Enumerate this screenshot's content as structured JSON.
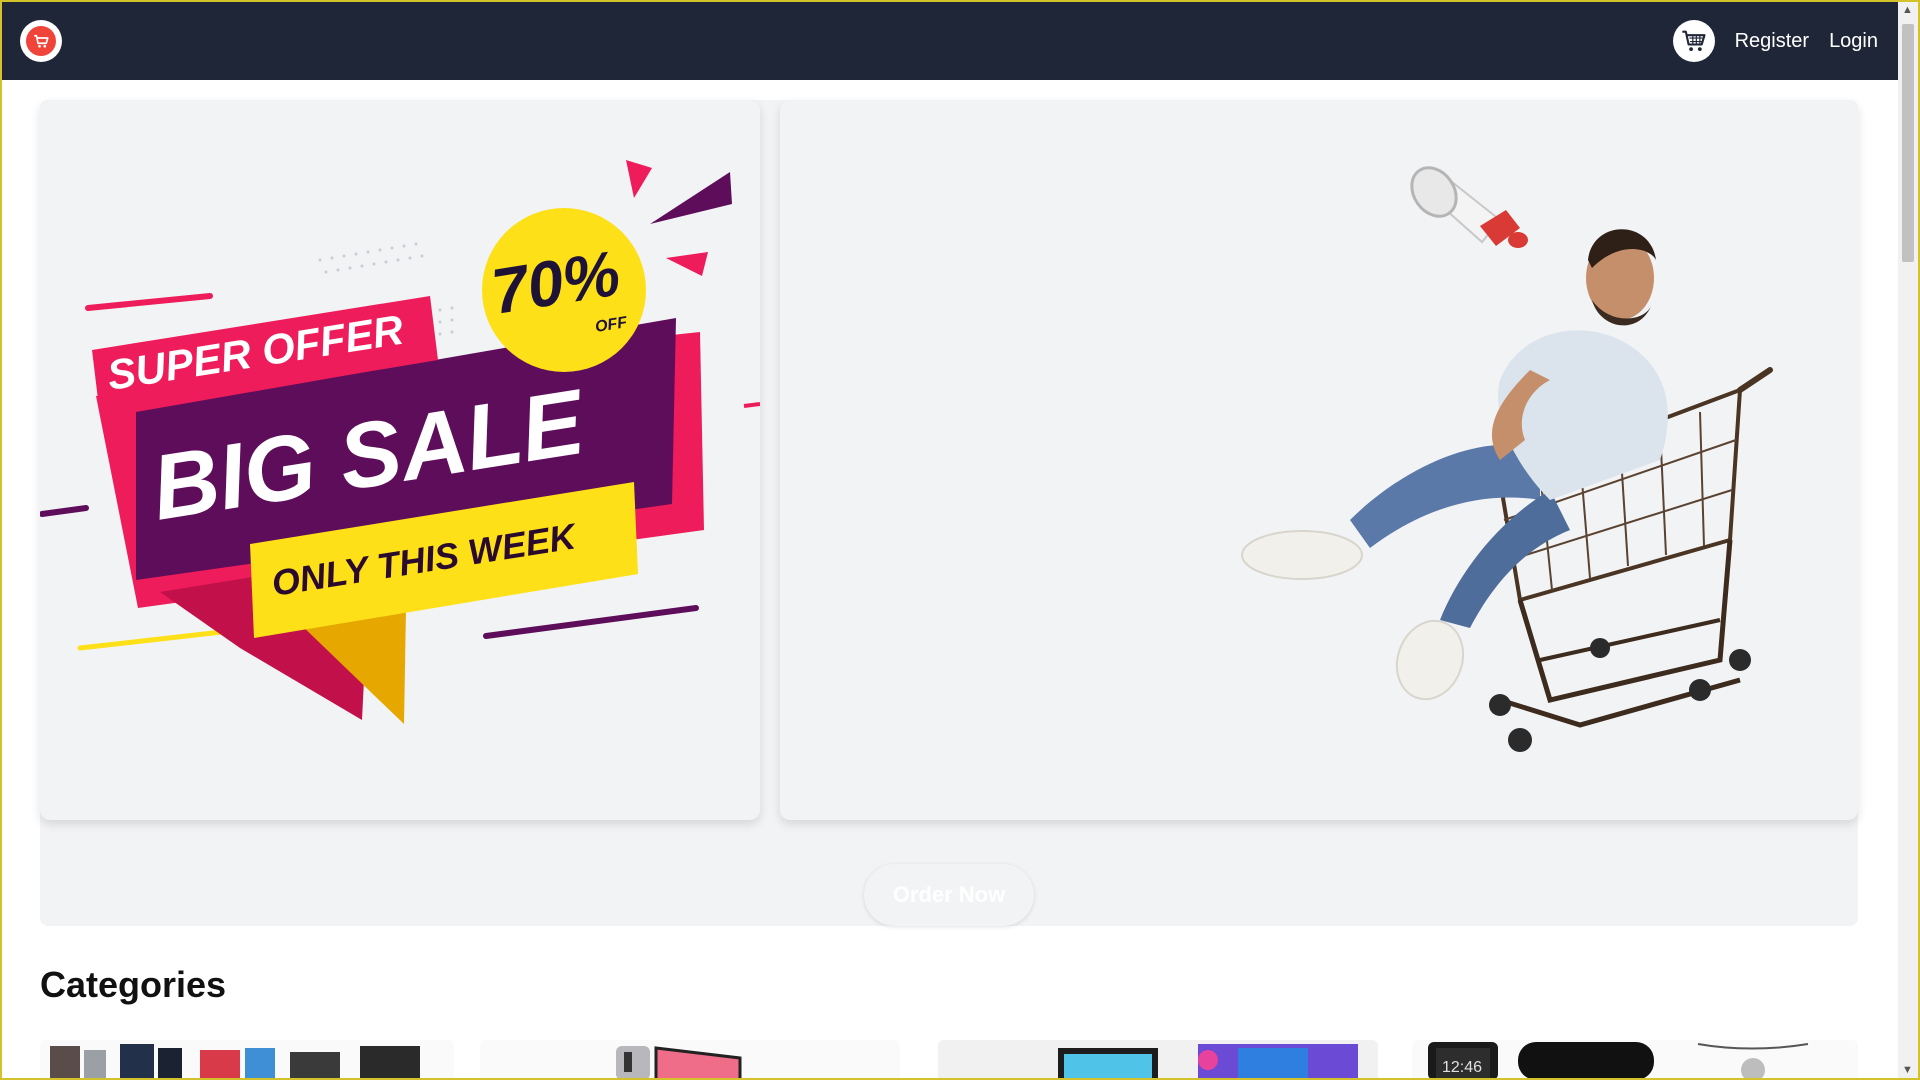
{
  "nav": {
    "register_label": "Register",
    "login_label": "Login",
    "logo_icon": "shopping-cart-logo-icon",
    "cart_icon": "shopping-cart-icon"
  },
  "hero": {
    "banner": {
      "super_offer": "SUPER OFFER",
      "percent": "70%",
      "off": "OFF",
      "big_sale": "BIG SALE",
      "only_this_week": "ONLY THIS WEEK"
    },
    "order_button_label": "Order Now"
  },
  "categories": {
    "title": "Categories"
  },
  "colors": {
    "navbar": "#1e2638",
    "accent_pink": "#ee1c5a",
    "accent_purple": "#5e0d5b",
    "accent_yellow": "#fde018"
  }
}
